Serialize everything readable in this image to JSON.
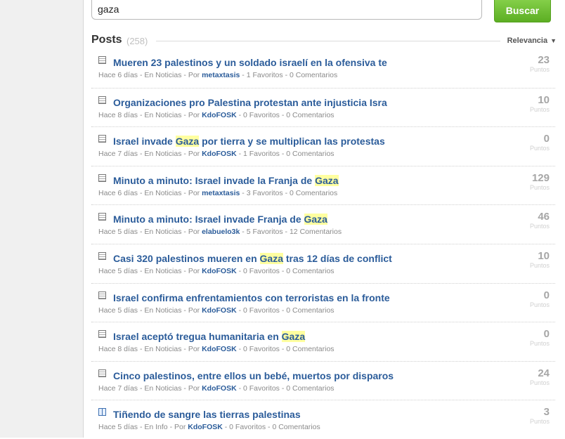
{
  "search": {
    "value": "gaza",
    "button_label": "Buscar"
  },
  "posts_header": {
    "title": "Posts",
    "count": "(258)",
    "sort_label": "Relevancia"
  },
  "points_label": "Puntos",
  "posts": [
    {
      "icon": "document-icon",
      "title": [
        {
          "t": "Mueren 23 palestinos y un soldado israelí en la ofensiva te",
          "hl": false
        }
      ],
      "age": "Hace 6 días",
      "section": "Noticias",
      "author": "metaxtasis",
      "favorites": "1 Favoritos",
      "comments": "0 Comentarios",
      "points": "23"
    },
    {
      "icon": "document-icon",
      "title": [
        {
          "t": "Organizaciones pro Palestina protestan ante injusticia Isra",
          "hl": false
        }
      ],
      "age": "Hace 8 días",
      "section": "Noticias",
      "author": "KdoFOSK",
      "favorites": "0 Favoritos",
      "comments": "0 Comentarios",
      "points": "10"
    },
    {
      "icon": "document-icon",
      "title": [
        {
          "t": "Israel invade ",
          "hl": false
        },
        {
          "t": "Gaza",
          "hl": true
        },
        {
          "t": " por tierra y se multiplican las protestas",
          "hl": false
        }
      ],
      "age": "Hace 7 días",
      "section": "Noticias",
      "author": "KdoFOSK",
      "favorites": "1 Favoritos",
      "comments": "0 Comentarios",
      "points": "0"
    },
    {
      "icon": "document-icon",
      "title": [
        {
          "t": "Minuto a minuto: Israel invade la Franja de ",
          "hl": false
        },
        {
          "t": "Gaza",
          "hl": true
        }
      ],
      "age": "Hace 6 días",
      "section": "Noticias",
      "author": "metaxtasis",
      "favorites": "3 Favoritos",
      "comments": "0 Comentarios",
      "points": "129"
    },
    {
      "icon": "document-icon",
      "title": [
        {
          "t": "Minuto a minuto: Israel invade Franja de ",
          "hl": false
        },
        {
          "t": "Gaza",
          "hl": true
        }
      ],
      "age": "Hace 5 días",
      "section": "Noticias",
      "author": "elabuelo3k",
      "favorites": "5 Favoritos",
      "comments": "12 Comentarios",
      "points": "46"
    },
    {
      "icon": "document-icon",
      "title": [
        {
          "t": "Casi 320 palestinos mueren en ",
          "hl": false
        },
        {
          "t": "Gaza",
          "hl": true
        },
        {
          "t": " tras 12 días de conflict",
          "hl": false
        }
      ],
      "age": "Hace 5 días",
      "section": "Noticias",
      "author": "KdoFOSK",
      "favorites": "0 Favoritos",
      "comments": "0 Comentarios",
      "points": "10"
    },
    {
      "icon": "document-icon",
      "title": [
        {
          "t": "Israel confirma enfrentamientos con terroristas en la fronte",
          "hl": false
        }
      ],
      "age": "Hace 5 días",
      "section": "Noticias",
      "author": "KdoFOSK",
      "favorites": "0 Favoritos",
      "comments": "0 Comentarios",
      "points": "0"
    },
    {
      "icon": "document-icon",
      "title": [
        {
          "t": "Israel aceptó tregua humanitaria en ",
          "hl": false
        },
        {
          "t": "Gaza",
          "hl": true
        }
      ],
      "age": "Hace 8 días",
      "section": "Noticias",
      "author": "KdoFOSK",
      "favorites": "0 Favoritos",
      "comments": "0 Comentarios",
      "points": "0"
    },
    {
      "icon": "document-icon",
      "title": [
        {
          "t": "Cinco palestinos, entre ellos un bebé, muertos por disparos",
          "hl": false
        }
      ],
      "age": "Hace 7 días",
      "section": "Noticias",
      "author": "KdoFOSK",
      "favorites": "0 Favoritos",
      "comments": "0 Comentarios",
      "points": "24"
    },
    {
      "icon": "book-icon",
      "title": [
        {
          "t": "Tiñendo de sangre las tierras palestinas",
          "hl": false
        }
      ],
      "age": "Hace 5 días",
      "section": "Info",
      "author": "KdoFOSK",
      "favorites": "0 Favoritos",
      "comments": "0 Comentarios",
      "points": "3"
    }
  ],
  "meta_words": {
    "in": "En",
    "by": "Por",
    "sep": " - "
  },
  "colors": {
    "link": "#2b5c9a",
    "button": "#6cbf35",
    "highlight": "#ffffa0"
  }
}
